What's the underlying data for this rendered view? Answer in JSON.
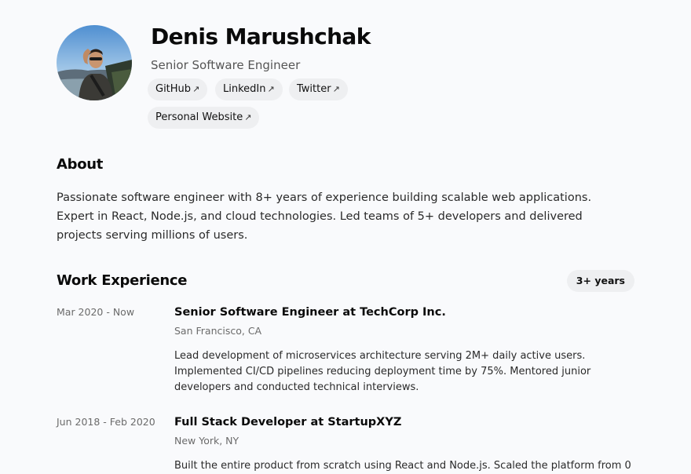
{
  "profile": {
    "name": "Denis Marushchak",
    "title": "Senior Software Engineer"
  },
  "links": [
    {
      "label": "GitHub",
      "icon": "external-link-arrow-icon"
    },
    {
      "label": "LinkedIn",
      "icon": "external-link-arrow-icon"
    },
    {
      "label": "Twitter",
      "icon": "external-link-arrow-icon"
    },
    {
      "label": "Personal Website",
      "icon": "external-link-arrow-icon"
    }
  ],
  "about": {
    "heading": "About",
    "text": "Passionate software engineer with 8+ years of experience building scalable web applications. Expert in React, Node.js, and cloud technologies. Led teams of 5+ developers and delivered projects serving millions of users."
  },
  "experience": {
    "heading": "Work Experience",
    "badge": "3+ years",
    "jobs": [
      {
        "dates": "Mar 2020 - Now",
        "role": "Senior Software Engineer at TechCorp Inc.",
        "location": "San Francisco, CA",
        "description": "Lead development of microservices architecture serving 2M+ daily active users. Implemented CI/CD pipelines reducing deployment time by 75%. Mentored junior developers and conducted technical interviews."
      },
      {
        "dates": "Jun 2018 - Feb 2020",
        "role": "Full Stack Developer at StartupXYZ",
        "location": "New York, NY",
        "description": "Built the entire product from scratch using React and Node.js. Scaled the platform from 0"
      }
    ]
  },
  "colors": {
    "background": "#f9fafc",
    "pill": "#eeeff1",
    "text": "#111111",
    "muted": "#6b6b6b"
  }
}
